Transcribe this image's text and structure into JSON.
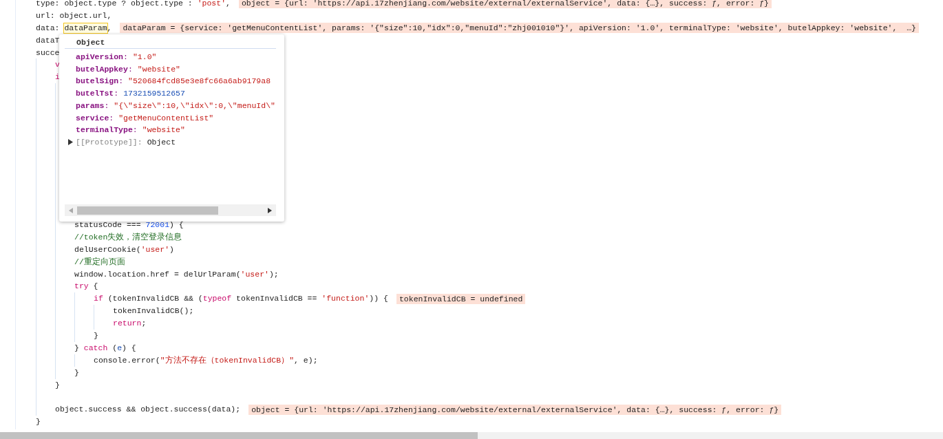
{
  "code_lines": [
    {
      "kind": "code",
      "tokens": [
        {
          "kind": "plain",
          "text": "type: object.type ? object.type : "
        },
        {
          "kind": "string",
          "text": "'post'"
        },
        {
          "kind": "plain",
          "text": ","
        }
      ],
      "inline_value": "object = {url: 'https://api.17zhenjiang.com/website/external/externalService', data: {…}, success: ƒ, error: ƒ}"
    },
    {
      "kind": "code",
      "tokens": [
        {
          "kind": "plain",
          "text": "url: object.url,"
        }
      ]
    },
    {
      "kind": "code",
      "tokens": [
        {
          "kind": "plain",
          "text": "data: "
        },
        {
          "kind": "hovered",
          "text": "dataParam"
        },
        {
          "kind": "plain",
          "text": ","
        }
      ],
      "inline_value": "dataParam = {service: 'getMenuContentList', params: '{\"size\":10,\"idx\":0,\"menuId\":\"zhj001010\"}', apiVersion: '1.0', terminalType: 'website', butelAppkey: 'website',  …}"
    },
    {
      "kind": "code",
      "tokens": [
        {
          "kind": "plain",
          "text": "dataT"
        }
      ]
    },
    {
      "kind": "code",
      "tokens": [
        {
          "kind": "plain",
          "text": "succe"
        }
      ],
      "children": [
        {
          "kind": "code",
          "tokens": [
            {
              "kind": "keyword",
              "text": "v"
            }
          ]
        },
        {
          "kind": "code",
          "tokens": [
            {
              "kind": "keyword",
              "text": "i"
            }
          ],
          "children": [
            {
              "kind": "blank"
            },
            {
              "kind": "blank"
            },
            {
              "kind": "blank"
            },
            {
              "kind": "blank"
            },
            {
              "kind": "blank"
            },
            {
              "kind": "blank"
            },
            {
              "kind": "blank"
            },
            {
              "kind": "blank"
            },
            {
              "kind": "blank"
            },
            {
              "kind": "blank"
            },
            {
              "kind": "blank"
            },
            {
              "kind": "code",
              "tokens": [
                {
                  "kind": "plain",
                  "text": "statusCode === "
                },
                {
                  "kind": "number",
                  "text": "72001"
                },
                {
                  "kind": "plain",
                  "text": ") {"
                }
              ]
            },
            {
              "kind": "code",
              "tokens": [
                {
                  "kind": "comment",
                  "text": "//token失效，清空登录信息"
                }
              ]
            },
            {
              "kind": "code",
              "tokens": [
                {
                  "kind": "plain",
                  "text": "delUserCookie("
                },
                {
                  "kind": "string",
                  "text": "'user'"
                },
                {
                  "kind": "plain",
                  "text": ")"
                }
              ]
            },
            {
              "kind": "code",
              "tokens": [
                {
                  "kind": "comment",
                  "text": "//重定向页面"
                }
              ]
            },
            {
              "kind": "code",
              "tokens": [
                {
                  "kind": "plain",
                  "text": "window.location.href = delUrlParam("
                },
                {
                  "kind": "string",
                  "text": "'user'"
                },
                {
                  "kind": "plain",
                  "text": ");"
                }
              ]
            },
            {
              "kind": "code",
              "tokens": [
                {
                  "kind": "keyword",
                  "text": "try"
                },
                {
                  "kind": "plain",
                  "text": " {"
                }
              ],
              "children": [
                {
                  "kind": "code",
                  "tokens": [
                    {
                      "kind": "keyword",
                      "text": "if"
                    },
                    {
                      "kind": "plain",
                      "text": " (tokenInvalidCB && ("
                    },
                    {
                      "kind": "keyword",
                      "text": "typeof"
                    },
                    {
                      "kind": "plain",
                      "text": " tokenInvalidCB == "
                    },
                    {
                      "kind": "string",
                      "text": "'function'"
                    },
                    {
                      "kind": "plain",
                      "text": ")) {"
                    }
                  ],
                  "inline_value": "tokenInvalidCB = undefined",
                  "children": [
                    {
                      "kind": "code",
                      "tokens": [
                        {
                          "kind": "plain",
                          "text": "tokenInvalidCB();"
                        }
                      ]
                    },
                    {
                      "kind": "code",
                      "tokens": [
                        {
                          "kind": "keyword",
                          "text": "return"
                        },
                        {
                          "kind": "plain",
                          "text": ";"
                        }
                      ]
                    }
                  ]
                },
                {
                  "kind": "code",
                  "tokens": [
                    {
                      "kind": "plain",
                      "text": "}"
                    }
                  ]
                }
              ]
            },
            {
              "kind": "code",
              "tokens": [
                {
                  "kind": "plain",
                  "text": "} "
                },
                {
                  "kind": "keyword",
                  "text": "catch"
                },
                {
                  "kind": "plain",
                  "text": " ("
                },
                {
                  "kind": "param",
                  "text": "e"
                },
                {
                  "kind": "plain",
                  "text": ") {"
                }
              ],
              "children": [
                {
                  "kind": "code",
                  "tokens": [
                    {
                      "kind": "plain",
                      "text": "console.error("
                    },
                    {
                      "kind": "string",
                      "text": "\"方法不存在（tokenInvalidCB）\""
                    },
                    {
                      "kind": "plain",
                      "text": ", e);"
                    }
                  ]
                }
              ]
            },
            {
              "kind": "code",
              "tokens": [
                {
                  "kind": "plain",
                  "text": "}"
                }
              ]
            }
          ]
        },
        {
          "kind": "code",
          "tokens": [
            {
              "kind": "plain",
              "text": "}"
            }
          ]
        },
        {
          "kind": "blank"
        },
        {
          "kind": "code",
          "tokens": [
            {
              "kind": "plain",
              "text": "object.success && object.success(data);"
            }
          ],
          "inline_value": "object = {url: 'https://api.17zhenjiang.com/website/external/externalService', data: {…}, success: ƒ, error: ƒ}"
        }
      ]
    },
    {
      "kind": "code",
      "tokens": [
        {
          "kind": "plain",
          "text": "}"
        }
      ]
    }
  ],
  "popover": {
    "title": "Object",
    "properties": [
      {
        "key": "**apiVersion**:",
        "value": "\"1.0\"",
        "kind": "string"
      },
      {
        "key": "**butelAppkey**:",
        "value": "\"website\"",
        "kind": "string"
      },
      {
        "key": "**butelSign**:",
        "value": "\"520684fcd85e3e8fc66a6ab9179a8",
        "kind": "string"
      },
      {
        "key": "**butelTst**:",
        "value": "1732159512657",
        "kind": "number"
      },
      {
        "key": "**params**:",
        "value": "\"{\\\"size\\\":10,\\\"idx\\\":0,\\\"menuId\\\"",
        "kind": "string"
      },
      {
        "key": "**service**:",
        "value": "\"getMenuContentList\"",
        "kind": "string"
      },
      {
        "key": "**terminalType**:",
        "value": "\"website\"",
        "kind": "string"
      }
    ],
    "prototype": {
      "label": "[[Prototype]]:",
      "value": "Object",
      "expanded": false
    }
  }
}
